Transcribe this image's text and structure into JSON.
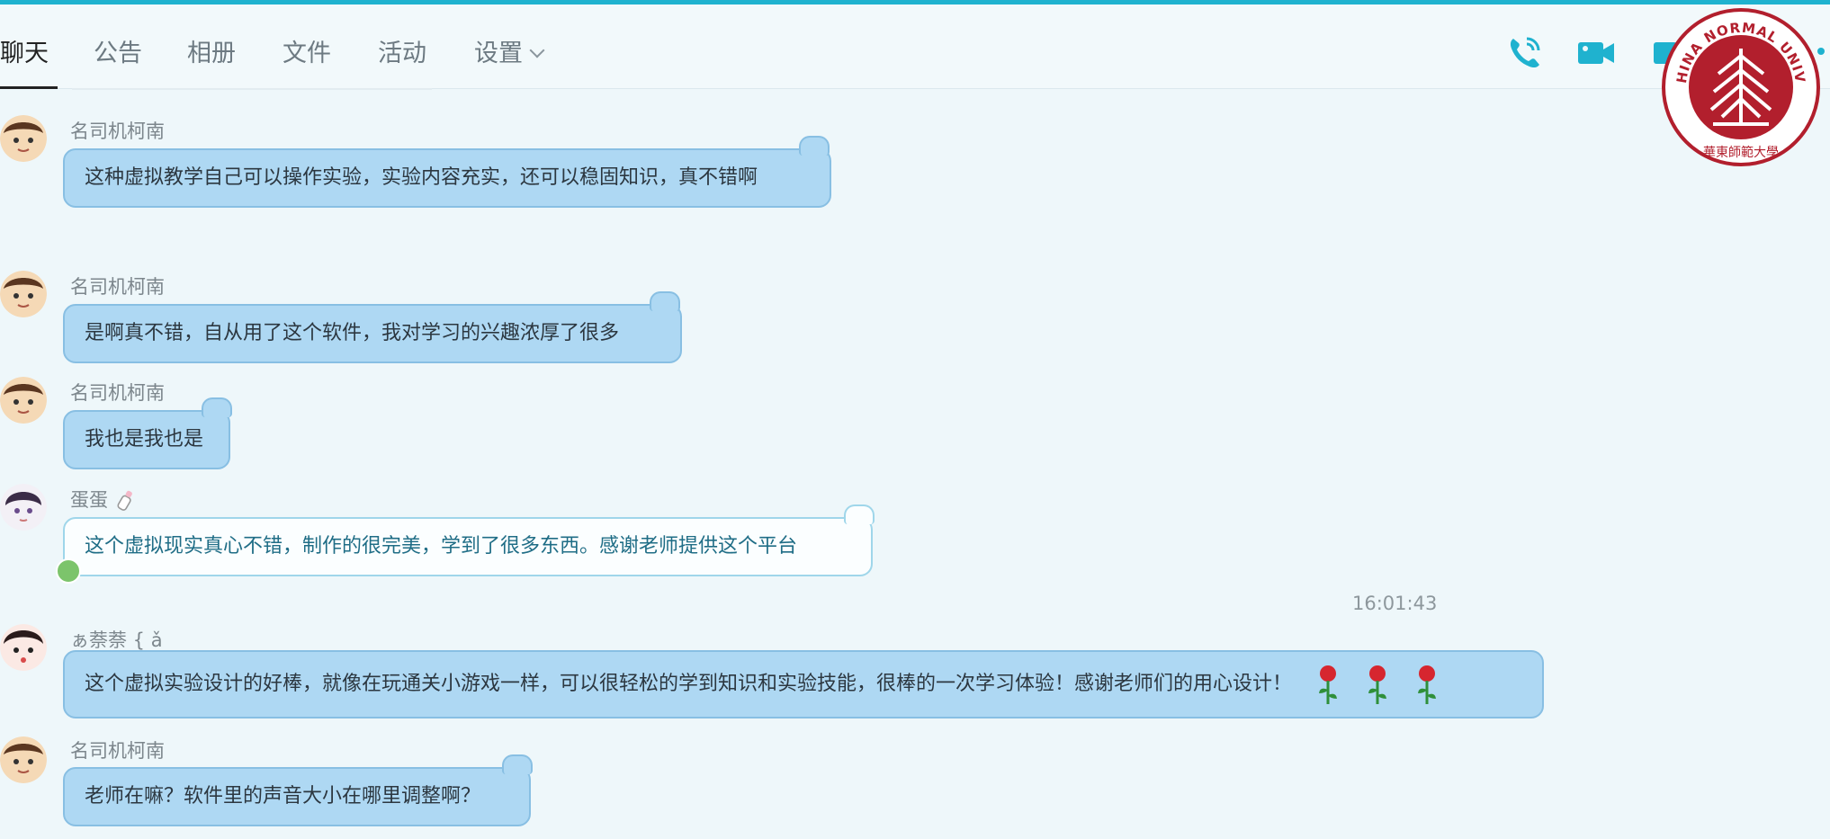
{
  "tabs": [
    {
      "label": "聊天",
      "active": true
    },
    {
      "label": "公告"
    },
    {
      "label": "相册"
    },
    {
      "label": "文件"
    },
    {
      "label": "活动"
    },
    {
      "label": "设置"
    }
  ],
  "header_icons": [
    "phone-icon",
    "video-call-icon"
  ],
  "logo": {
    "text": "EAST CHINA NORMAL UNIVERSITY",
    "sub": "華東師範大學"
  },
  "timestamp": "16:01:43",
  "messages": [
    {
      "nick": "名司机柯南",
      "text": "这种虚拟教学自己可以操作实验，实验内容充实，还可以稳固知识，真不错啊"
    },
    {
      "nick": "名司机柯南",
      "text": "是啊真不错，自从用了这个软件，我对学习的兴趣浓厚了很多"
    },
    {
      "nick": "名司机柯南",
      "text": "我也是我也是"
    },
    {
      "nick": "蛋蛋",
      "text": "这个虚拟现实真心不错，制作的很完美，学到了很多东西。感谢老师提供这个平台"
    },
    {
      "nick": "ぁ萘萘 { ǎ",
      "text": "这个虚拟实验设计的好棒，就像在玩通关小游戏一样，可以很轻松的学到知识和实验技能，很棒的一次学习体验！感谢老师们的用心设计！"
    },
    {
      "nick": "名司机柯南",
      "text": "老师在嘛？软件里的声音大小在哪里调整啊？"
    }
  ],
  "colors": {
    "accent": "#1fb2cf",
    "bubble": "#aed8f3",
    "logo_red": "#b21f2d"
  }
}
